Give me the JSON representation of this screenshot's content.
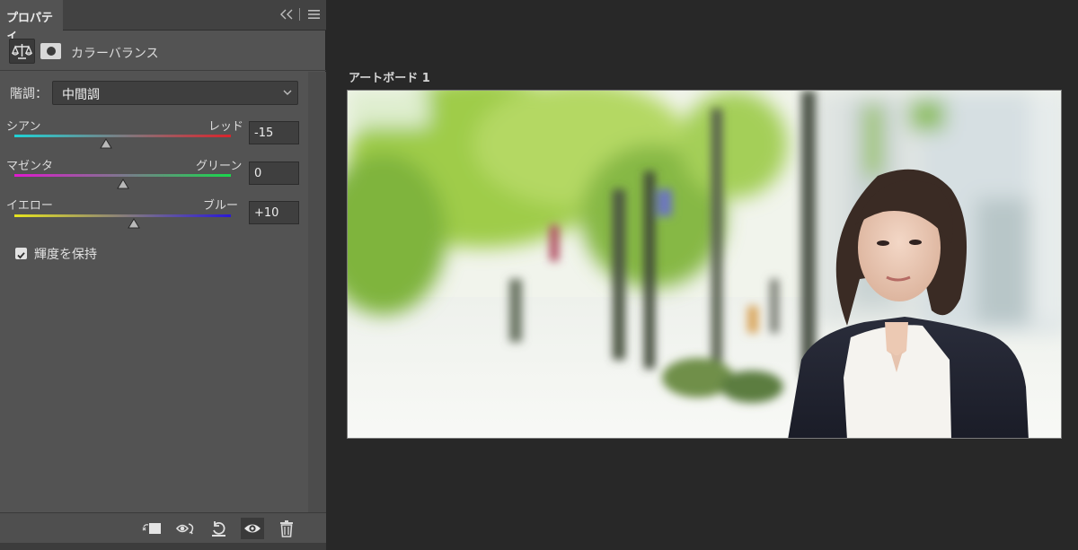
{
  "panel": {
    "tab_label": "プロパティ",
    "adjustment_title": "カラーバランス",
    "tone": {
      "label": "階調：",
      "selected": "中間調"
    },
    "sliders": [
      {
        "left_label": "シアン",
        "right_label": "レッド",
        "value": "-15",
        "numeric": -15,
        "gradient": [
          "#1fd3d6",
          "#d9242c"
        ]
      },
      {
        "left_label": "マゼンタ",
        "right_label": "グリーン",
        "value": "0",
        "numeric": 0,
        "gradient": [
          "#e019cf",
          "#19d84c"
        ]
      },
      {
        "left_label": "イエロー",
        "right_label": "ブルー",
        "value": "+10",
        "numeric": 10,
        "gradient": [
          "#e6e41e",
          "#2a19d6"
        ]
      }
    ],
    "preserve_luminosity": {
      "label": "輝度を保持",
      "checked": true
    },
    "footer_icons": [
      "clip-to-layer-icon",
      "view-previous-state-icon",
      "reset-icon",
      "visibility-eye-icon",
      "trash-icon"
    ]
  },
  "canvas": {
    "artboard_label": "アートボード 1"
  }
}
